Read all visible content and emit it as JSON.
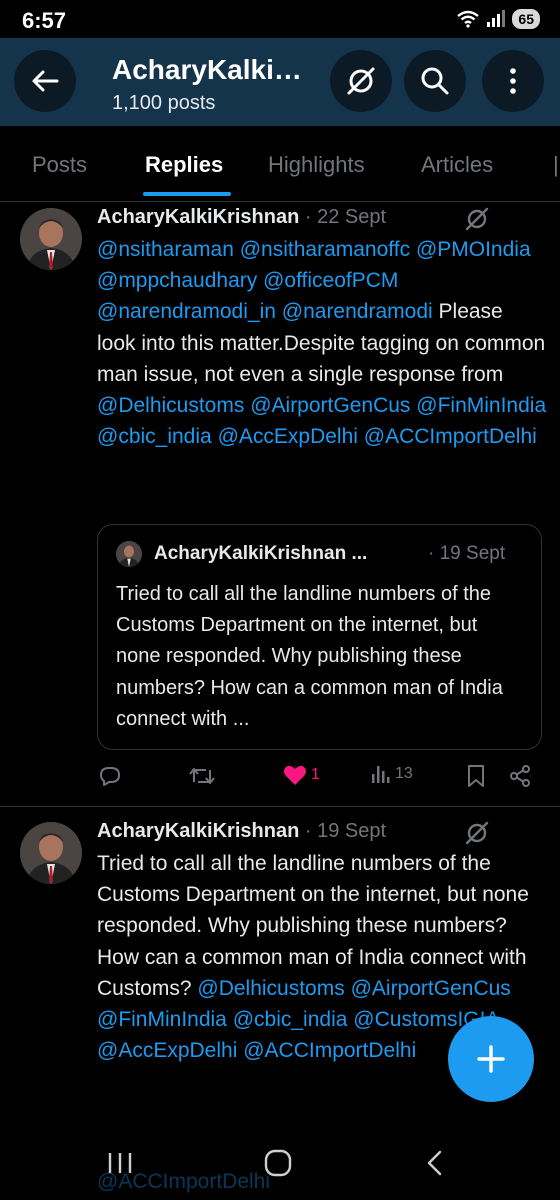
{
  "status_bar": {
    "time": "6:57",
    "battery": "65"
  },
  "header": {
    "title": "AcharyKalkiKrishnan",
    "post_count": "1,100 posts"
  },
  "tabs": [
    {
      "label": "Posts",
      "active": false
    },
    {
      "label": "Replies",
      "active": true
    },
    {
      "label": "Highlights",
      "active": false
    },
    {
      "label": "Articles",
      "active": false
    }
  ],
  "tweets": [
    {
      "author": "AcharyKalkiKrishnan",
      "date": "· 22 Sept",
      "body": {
        "m1": "@nsitharaman",
        "m2": "@nsitharamanoffc",
        "m3": "@PMOIndia",
        "m4": "@mppchaudhary",
        "m5": "@officeofPCM",
        "m6": "@narendramodi_in",
        "m7": "@narendramodi",
        "t1": "Please look into this matter.Despite tagging on common man issue, not even a single response from",
        "m8": "@Delhicustoms",
        "m9": "@AirportGenCus",
        "m10": "@FinMinIndia",
        "m11": "@cbic_india",
        "m12": "@AccExpDelhi",
        "m13": "@ACCImportDelhi"
      },
      "quote": {
        "author": "AcharyKalkiKrishnan ...",
        "date": "· 19 Sept",
        "text": "Tried to call all the landline numbers of the Customs Department on the internet, but none responded. Why publishing these numbers? How can a common man of India connect with ..."
      },
      "actions": {
        "likes": "1",
        "views": "13"
      }
    },
    {
      "author": "AcharyKalkiKrishnan",
      "date": "· 19 Sept",
      "body": {
        "t1": "Tried to call all the landline numbers of the Customs Department on the internet, but none responded. Why publishing these numbers? How can a common man of India connect with Customs?",
        "m1": "@Delhicustoms",
        "m2": "@AirportGenCus",
        "m3": "@FinMinIndia",
        "m4": "@cbic_india",
        "m5": "@CustomsIGIA",
        "m6": "@AccExpDelhi",
        "m7": "@ACCImportDelhi"
      },
      "ghost_text": "@ACCImportDelhi"
    }
  ],
  "colors": {
    "accent": "#1d9bf0",
    "header_bg": "#14344c",
    "like": "#f91880"
  },
  "icons": [
    "back-arrow-icon",
    "grok-icon",
    "search-icon",
    "more-vertical-icon",
    "reply-icon",
    "retweet-icon",
    "heart-icon",
    "views-icon",
    "bookmark-icon",
    "share-icon",
    "plus-icon"
  ]
}
